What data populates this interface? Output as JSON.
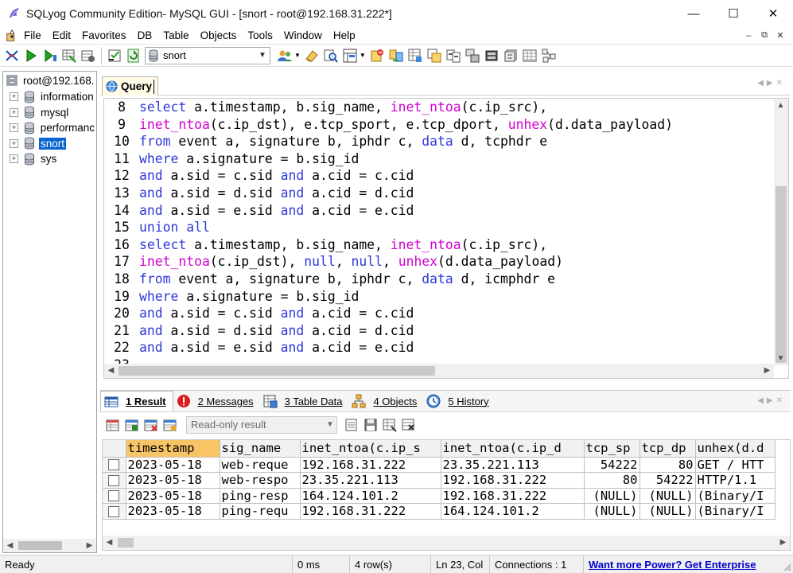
{
  "window": {
    "title": "SQLyog Community Edition- MySQL GUI - [snort - root@192.168.31.222*]",
    "minimize": "—",
    "maximize": "☐",
    "close": "✕"
  },
  "menu": {
    "items": [
      "File",
      "Edit",
      "Favorites",
      "DB",
      "Table",
      "Objects",
      "Tools",
      "Window",
      "Help"
    ],
    "mdi": [
      "–",
      "⧉",
      "✕"
    ]
  },
  "toolbar": {
    "database": "snort"
  },
  "browser": {
    "root": "root@192.168.",
    "databases": [
      "information",
      "mysql",
      "performanc",
      "snort",
      "sys"
    ],
    "selected": "snort"
  },
  "query_tab": {
    "label": "Query"
  },
  "editor": {
    "lines": [
      {
        "n": "8",
        "tokens": [
          [
            "kw",
            "select"
          ],
          [
            "id",
            " a.timestamp, b.sig_name, "
          ],
          [
            "fn",
            "inet_ntoa"
          ],
          [
            "id",
            "(c.ip_src),"
          ]
        ]
      },
      {
        "n": "9",
        "tokens": [
          [
            "fn",
            "inet_ntoa"
          ],
          [
            "id",
            "(c.ip_dst), e.tcp_sport, e.tcp_dport, "
          ],
          [
            "fn",
            "unhex"
          ],
          [
            "id",
            "(d.data_payload)"
          ]
        ]
      },
      {
        "n": "10",
        "tokens": [
          [
            "kw",
            "from"
          ],
          [
            "id",
            " event a, signature b, iphdr c, "
          ],
          [
            "kw",
            "data"
          ],
          [
            "id",
            " d, tcphdr e"
          ]
        ]
      },
      {
        "n": "11",
        "tokens": [
          [
            "kw",
            "where"
          ],
          [
            "id",
            " a.signature = b.sig_id"
          ]
        ]
      },
      {
        "n": "12",
        "tokens": [
          [
            "kw",
            "and"
          ],
          [
            "id",
            " a.sid = c.sid "
          ],
          [
            "kw",
            "and"
          ],
          [
            "id",
            " a.cid = c.cid"
          ]
        ]
      },
      {
        "n": "13",
        "tokens": [
          [
            "kw",
            "and"
          ],
          [
            "id",
            " a.sid = d.sid "
          ],
          [
            "kw",
            "and"
          ],
          [
            "id",
            " a.cid = d.cid"
          ]
        ]
      },
      {
        "n": "14",
        "tokens": [
          [
            "kw",
            "and"
          ],
          [
            "id",
            " a.sid = e.sid "
          ],
          [
            "kw",
            "and"
          ],
          [
            "id",
            " a.cid = e.cid"
          ]
        ]
      },
      {
        "n": "15",
        "tokens": [
          [
            "kw",
            "union all"
          ]
        ]
      },
      {
        "n": "16",
        "tokens": [
          [
            "kw",
            "select"
          ],
          [
            "id",
            " a.timestamp, b.sig_name, "
          ],
          [
            "fn",
            "inet_ntoa"
          ],
          [
            "id",
            "(c.ip_src),"
          ]
        ]
      },
      {
        "n": "17",
        "tokens": [
          [
            "fn",
            "inet_ntoa"
          ],
          [
            "id",
            "(c.ip_dst), "
          ],
          [
            "kw",
            "null"
          ],
          [
            "id",
            ", "
          ],
          [
            "kw",
            "null"
          ],
          [
            "id",
            ", "
          ],
          [
            "fn",
            "unhex"
          ],
          [
            "id",
            "(d.data_payload)"
          ]
        ]
      },
      {
        "n": "18",
        "tokens": [
          [
            "kw",
            "from"
          ],
          [
            "id",
            " event a, signature b, iphdr c, "
          ],
          [
            "kw",
            "data"
          ],
          [
            "id",
            " d, icmphdr e"
          ]
        ]
      },
      {
        "n": "19",
        "tokens": [
          [
            "kw",
            "where"
          ],
          [
            "id",
            " a.signature = b.sig_id"
          ]
        ]
      },
      {
        "n": "20",
        "tokens": [
          [
            "kw",
            "and"
          ],
          [
            "id",
            " a.sid = c.sid "
          ],
          [
            "kw",
            "and"
          ],
          [
            "id",
            " a.cid = c.cid"
          ]
        ]
      },
      {
        "n": "21",
        "tokens": [
          [
            "kw",
            "and"
          ],
          [
            "id",
            " a.sid = d.sid "
          ],
          [
            "kw",
            "and"
          ],
          [
            "id",
            " a.cid = d.cid"
          ]
        ]
      },
      {
        "n": "22",
        "tokens": [
          [
            "kw",
            "and"
          ],
          [
            "id",
            " a.sid = e.sid "
          ],
          [
            "kw",
            "and"
          ],
          [
            "id",
            " a.cid = e.cid"
          ]
        ]
      },
      {
        "n": "23",
        "tokens": []
      }
    ]
  },
  "result_tabs": [
    {
      "label": "1 Result",
      "icon": "result-grid-icon",
      "active": true
    },
    {
      "label": "2 Messages",
      "icon": "messages-icon",
      "active": false
    },
    {
      "label": "3 Table Data",
      "icon": "table-data-icon",
      "active": false
    },
    {
      "label": "4 Objects",
      "icon": "objects-icon",
      "active": false
    },
    {
      "label": "5 History",
      "icon": "history-icon",
      "active": false
    }
  ],
  "result_toolbar": {
    "mode": "Read-only result"
  },
  "grid": {
    "columns": [
      "timestamp",
      "sig_name",
      "inet_ntoa(c.ip_s",
      "inet_ntoa(c.ip_d",
      "tcp_sp",
      "tcp_dp",
      "unhex(d.d"
    ],
    "rows": [
      [
        "2023-05-18",
        "web-reque",
        "192.168.31.222",
        "23.35.221.113",
        "54222",
        "80",
        "GET / HTT"
      ],
      [
        "2023-05-18",
        "web-respo",
        "23.35.221.113",
        "192.168.31.222",
        "80",
        "54222",
        "HTTP/1.1"
      ],
      [
        "2023-05-18",
        "ping-resp",
        "164.124.101.2",
        "192.168.31.222",
        "(NULL)",
        "(NULL)",
        "(Binary/I"
      ],
      [
        "2023-05-18",
        "ping-requ",
        "192.168.31.222",
        "164.124.101.2",
        "(NULL)",
        "(NULL)",
        "(Binary/I"
      ]
    ]
  },
  "status": {
    "state": "Ready",
    "time": "0 ms",
    "rows": "4 row(s)",
    "position": "Ln 23, Col",
    "connections": "Connections : 1",
    "promo": "Want more Power? Get Enterprise"
  },
  "colors": {
    "keyword": "#2f39d8",
    "function": "#d100d1",
    "selection": "#0a64d2",
    "sorted_header": "#f8c468",
    "promo_link": "#0000cc"
  }
}
